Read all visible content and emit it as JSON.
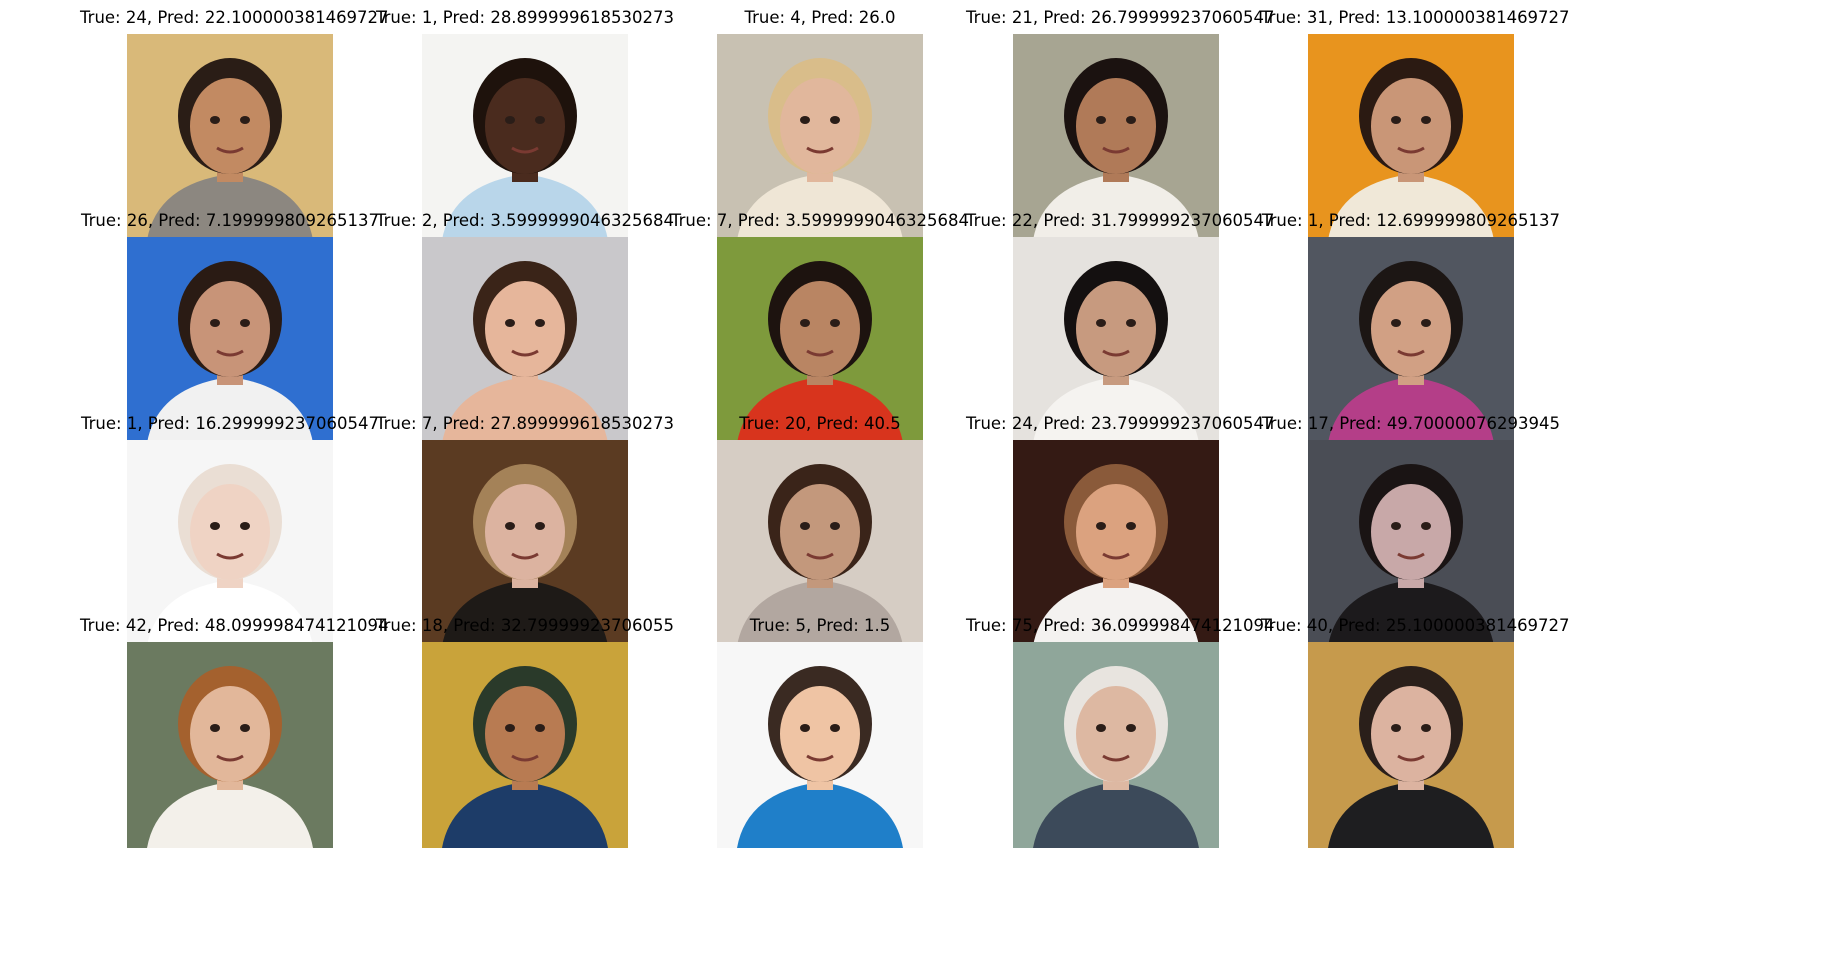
{
  "panels": [
    {
      "true_age": 24,
      "pred": "22.100000381469727",
      "title": "True: 24, Pred: 22.100000381469727",
      "bg": "#d9b979",
      "skin": "#c28a62",
      "hair": "#2a1d16",
      "cloth": "#8c8780"
    },
    {
      "true_age": 1,
      "pred": "28.899999618530273",
      "title": "True: 1, Pred: 28.899999618530273",
      "bg": "#f4f4f2",
      "skin": "#4a2b1e",
      "hair": "#1e120c",
      "cloth": "#b9d6ea"
    },
    {
      "true_age": 4,
      "pred": "26.0",
      "title": "True: 4, Pred: 26.0",
      "bg": "#c8c1b2",
      "skin": "#e1b79c",
      "hair": "#d9bd8a",
      "cloth": "#efe6d6"
    },
    {
      "true_age": 21,
      "pred": "26.799999237060547",
      "title": "True: 21, Pred: 26.799999237060547",
      "bg": "#a7a592",
      "skin": "#b07a58",
      "hair": "#1b1210",
      "cloth": "#f1eee8"
    },
    {
      "true_age": 31,
      "pred": "13.100000381469727",
      "title": "True: 31, Pred: 13.100000381469727",
      "bg": "#e8941e",
      "skin": "#c99677",
      "hair": "#2b1a12",
      "cloth": "#f0e8d8"
    },
    {
      "true_age": 26,
      "pred": "7.199999809265137",
      "title": "True: 26, Pred: 7.199999809265137",
      "bg": "#2f6fd0",
      "skin": "#c89478",
      "hair": "#2a1b14",
      "cloth": "#f1f1f1"
    },
    {
      "true_age": 2,
      "pred": "3.5999999046325684",
      "title": "True: 2, Pred: 3.5999999046325684",
      "bg": "#c9c8cb",
      "skin": "#e6b69b",
      "hair": "#3a2418",
      "cloth": "#e6b69b"
    },
    {
      "true_age": 7,
      "pred": "3.5999999046325684",
      "title": "True: 7, Pred: 3.5999999046325684",
      "bg": "#7e9a3c",
      "skin": "#b98563",
      "hair": "#1d130f",
      "cloth": "#d8341d"
    },
    {
      "true_age": 22,
      "pred": "31.799999237060547",
      "title": "True: 22, Pred: 31.799999237060547",
      "bg": "#e5e2de",
      "skin": "#c79a7f",
      "hair": "#141010",
      "cloth": "#f5f3f0"
    },
    {
      "true_age": 1,
      "pred": "12.699999809265137",
      "title": "True: 1, Pred: 12.699999809265137",
      "bg": "#515660",
      "skin": "#d1a084",
      "hair": "#1c1614",
      "cloth": "#b43e88"
    },
    {
      "true_age": 1,
      "pred": "16.299999237060547",
      "title": "True: 1, Pred: 16.299999237060547",
      "bg": "#f6f6f6",
      "skin": "#efd3c4",
      "hair": "#eaded4",
      "cloth": "#ffffff"
    },
    {
      "true_age": 7,
      "pred": "27.899999618530273",
      "title": "True: 7, Pred: 27.899999618530273",
      "bg": "#5b3b22",
      "skin": "#dcb3a0",
      "hair": "#a48258",
      "cloth": "#1e1a17"
    },
    {
      "true_age": 20,
      "pred": "40.5",
      "title": "True: 20, Pred: 40.5",
      "bg": "#d6cdc4",
      "skin": "#c3987c",
      "hair": "#3a2419",
      "cloth": "#b2a7a0"
    },
    {
      "true_age": 24,
      "pred": "23.799999237060547",
      "title": "True: 24, Pred: 23.799999237060547",
      "bg": "#341a14",
      "skin": "#dba27f",
      "hair": "#8a5a3a",
      "cloth": "#f4f2f0"
    },
    {
      "true_age": 17,
      "pred": "49.70000076293945",
      "title": "True: 17, Pred: 49.70000076293945",
      "bg": "#4a4d55",
      "skin": "#c8a8a8",
      "hair": "#1a1414",
      "cloth": "#1c1a1c"
    },
    {
      "true_age": 42,
      "pred": "48.099998474121094",
      "title": "True: 42, Pred: 48.099998474121094",
      "bg": "#6b7a60",
      "skin": "#e2b79a",
      "hair": "#a4612e",
      "cloth": "#f3f0ea"
    },
    {
      "true_age": 18,
      "pred": "32.79999923706055",
      "title": "True: 18, Pred: 32.79999923706055",
      "bg": "#c9a33a",
      "skin": "#b87b52",
      "hair": "#2a3a2a",
      "cloth": "#1d3c68"
    },
    {
      "true_age": 5,
      "pred": "1.5",
      "title": "True: 5, Pred: 1.5",
      "bg": "#f7f7f7",
      "skin": "#efc4a4",
      "hair": "#3a2a22",
      "cloth": "#1f7fc9"
    },
    {
      "true_age": 75,
      "pred": "36.099998474121094",
      "title": "True: 75, Pred: 36.099998474121094",
      "bg": "#8fa69a",
      "skin": "#ddb8a2",
      "hair": "#e8e4df",
      "cloth": "#3c4a5a"
    },
    {
      "true_age": 40,
      "pred": "25.100000381469727",
      "title": "True: 40, Pred: 25.100000381469727",
      "bg": "#c69a4c",
      "skin": "#dcb3a0",
      "hair": "#2a1f1a",
      "cloth": "#1e1e20"
    }
  ]
}
